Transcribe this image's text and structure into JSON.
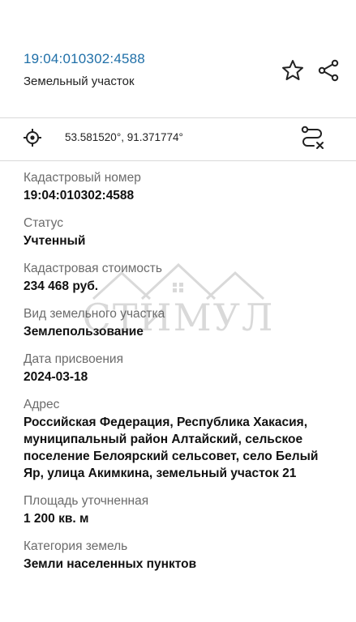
{
  "header": {
    "cadastral_link": "19:04:010302:4588",
    "subtitle": "Земельный участок",
    "icons": {
      "favorite": "star-icon",
      "share": "share-icon"
    }
  },
  "location": {
    "coordinates": "53.581520°, 91.371774°",
    "icons": {
      "locate": "target-icon",
      "route": "route-icon"
    }
  },
  "fields": [
    {
      "label": "Кадастровый номер",
      "value": "19:04:010302:4588"
    },
    {
      "label": "Статус",
      "value": "Учтенный"
    },
    {
      "label": "Кадастровая стоимость",
      "value": "234 468 руб."
    },
    {
      "label": "Вид земельного участка",
      "value": "Землепользование"
    },
    {
      "label": "Дата присвоения",
      "value": "2024-03-18"
    },
    {
      "label": "Адрес",
      "value": "Российская Федерация, Республика Хакасия, муниципальный район Алтайский, сельское поселение Белоярский сельсовет, село Белый Яр, улица Акимкина, земельный участок 21"
    },
    {
      "label": "Площадь уточненная",
      "value": "1 200 кв. м"
    },
    {
      "label": "Категория земель",
      "value": "Земли населенных пунктов"
    }
  ],
  "watermark": {
    "text": "СТИМУЛ"
  },
  "colors": {
    "link": "#1f6fa8",
    "label": "#6b6b6b",
    "divider": "#d9d9d9"
  }
}
